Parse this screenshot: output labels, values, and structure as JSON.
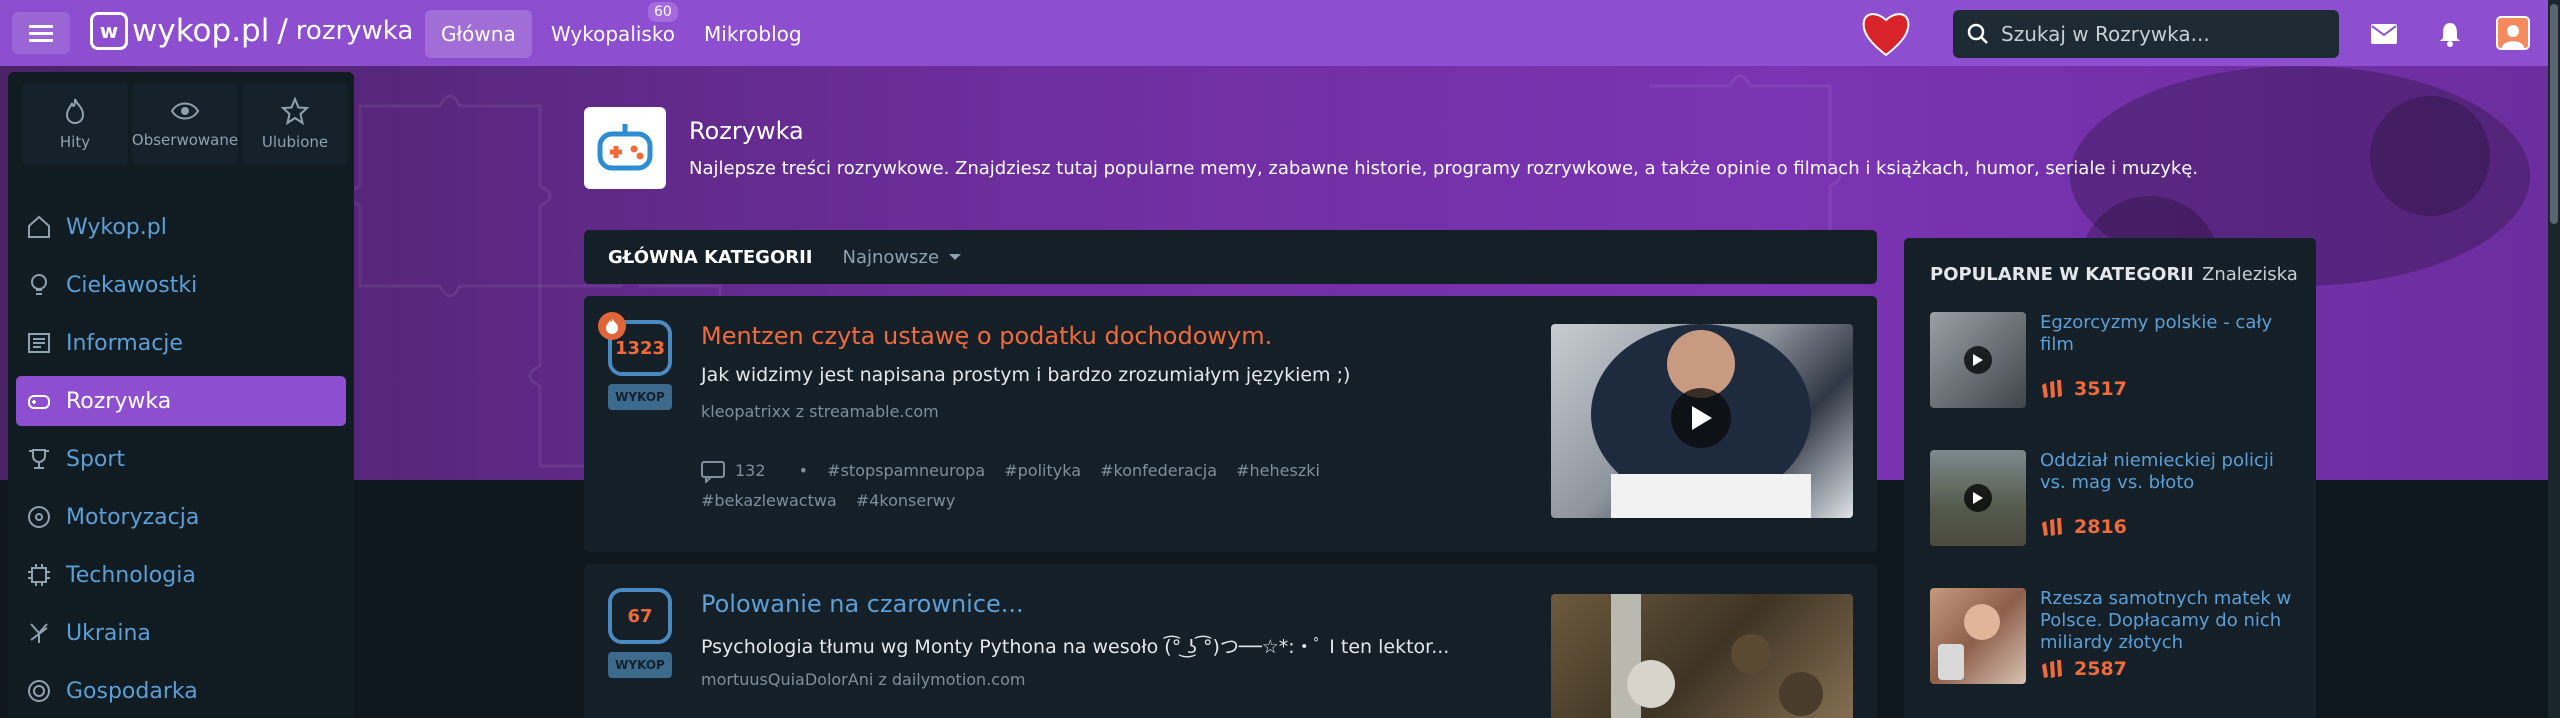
{
  "header": {
    "logo": "wykop.pl",
    "separator": "/",
    "section": "rozrywka",
    "nav": [
      {
        "label": "Główna"
      },
      {
        "label": "Wykopalisko",
        "badge": "60"
      },
      {
        "label": "Mikroblog"
      }
    ],
    "search_placeholder": "Szukaj w Rozrywka..."
  },
  "sidebar": {
    "quick": [
      {
        "label": "Hity",
        "icon": "flame-icon"
      },
      {
        "label": "Obserwowane",
        "icon": "eye-icon"
      },
      {
        "label": "Ulubione",
        "icon": "star-icon"
      }
    ],
    "items": [
      {
        "label": "Wykop.pl",
        "icon": "home-icon"
      },
      {
        "label": "Ciekawostki",
        "icon": "bulb-icon"
      },
      {
        "label": "Informacje",
        "icon": "newspaper-icon"
      },
      {
        "label": "Rozrywka",
        "icon": "gamepad-icon",
        "active": true
      },
      {
        "label": "Sport",
        "icon": "trophy-icon"
      },
      {
        "label": "Motoryzacja",
        "icon": "steering-wheel-icon"
      },
      {
        "label": "Technologia",
        "icon": "chip-icon"
      },
      {
        "label": "Ukraina",
        "icon": "ukraine-icon"
      },
      {
        "label": "Gospodarka",
        "icon": "coin-icon"
      }
    ]
  },
  "category": {
    "title": "Rozrywka",
    "description": "Najlepsze treści rozrywkowe. Znajdziesz tutaj popularne memy, zabawne historie, programy rozrywkowe, a także opinie o filmach i książkach, humor, seriale i muzykę."
  },
  "filter": {
    "main_tab": "GŁÓWNA KATEGORII",
    "sort": "Najnowsze"
  },
  "posts": [
    {
      "votes": "1323",
      "button": "WYKOP",
      "title": "Mentzen czyta ustawę o podatku dochodowym.",
      "description": "Jak widzimy jest napisana prostym i bardzo zrozumiałym językiem ;)",
      "source": "kleopatrixx z streamable.com",
      "comments": "132",
      "bullet": "•",
      "tags": [
        "#stopspamneuropa",
        "#polityka",
        "#konfederacja",
        "#heheszki",
        "#bekazlewactwa",
        "#4konserwy"
      ]
    },
    {
      "votes": "67",
      "button": "WYKOP",
      "title": "Polowanie na czarownice...",
      "description": "Psychologia tłumu wg Monty Pythona na wesoło (͡° ͜ʖ ͡°)つ──☆*:・ﾟ I ten lektor...",
      "source": "mortuusQuiaDolorAni z dailymotion.com"
    }
  ],
  "popular": {
    "heading": "POPULARNE W KATEGORII",
    "tab": "Znaleziska",
    "items": [
      {
        "title": "Egzorcyzmy polskie - cały film",
        "score": "3517"
      },
      {
        "title": "Oddział niemieckiej policji vs. mag vs. błoto",
        "score": "2816"
      },
      {
        "title": "Rzesza samotnych matek w Polsce. Dopłacamy do nich miliardy złotych",
        "score": "2587"
      }
    ]
  },
  "colors": {
    "brand": "#8d4fcf",
    "accent": "#f06a3a",
    "link": "#5c9fd6",
    "background": "#0f171e",
    "panel": "#141f27"
  }
}
